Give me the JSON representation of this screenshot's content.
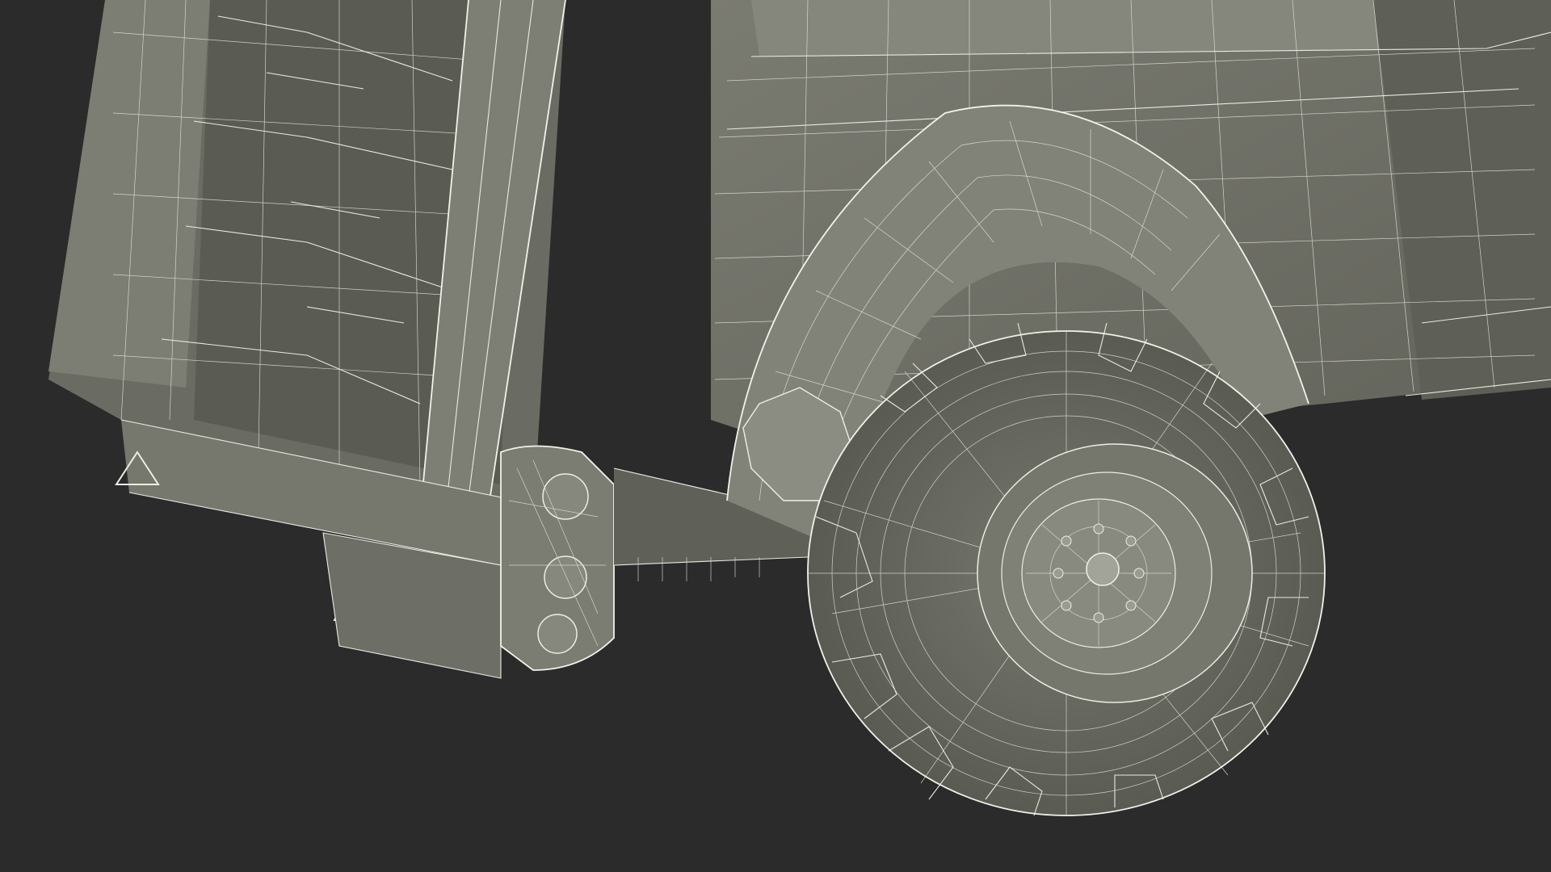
{
  "scene": {
    "subject": "manure-spreader-wireframe",
    "colors": {
      "background": "#2b2b2b",
      "body_fill": "#6f7066",
      "body_dark": "#55564e",
      "body_light": "#8a8b81",
      "wire": "#e9eae2"
    },
    "icons": [
      "warning-triangle-icon",
      "warning-triangle-icon",
      "bolt-icon"
    ]
  }
}
